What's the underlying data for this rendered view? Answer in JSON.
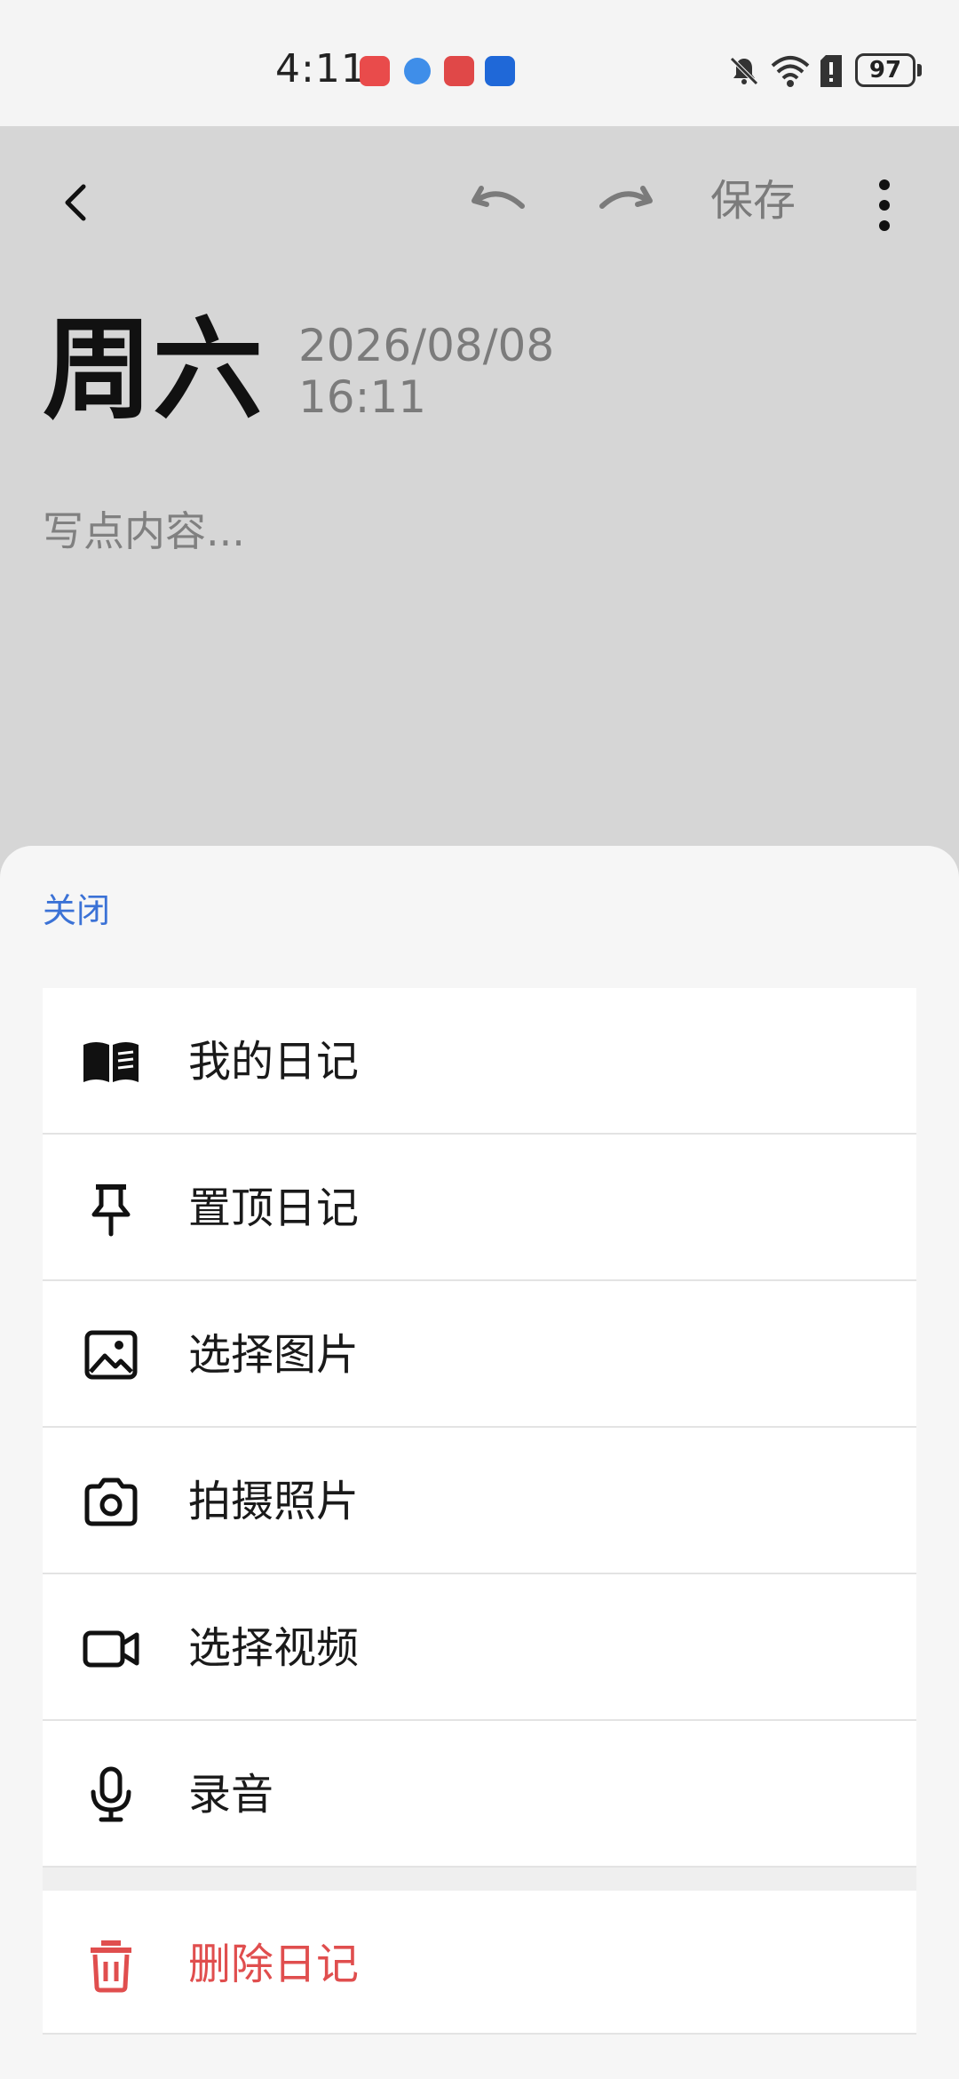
{
  "status_bar": {
    "time": "4:11",
    "app_icons": [
      "huawei-appgallery-icon",
      "browser-icon",
      "reader-icon",
      "tips-icon"
    ],
    "battery": "97"
  },
  "editor": {
    "save_label": "保存",
    "weekday": "周六",
    "date": "2026/08/08",
    "time": "16:11",
    "content_placeholder": "写点内容..."
  },
  "sheet": {
    "close_label": "关闭",
    "items": [
      {
        "label": "我的日记",
        "icon": "book-icon"
      },
      {
        "label": "置顶日记",
        "icon": "pin-icon"
      },
      {
        "label": "选择图片",
        "icon": "image-icon"
      },
      {
        "label": "拍摄照片",
        "icon": "camera-icon"
      },
      {
        "label": "选择视频",
        "icon": "video-icon"
      },
      {
        "label": "录音",
        "icon": "microphone-icon"
      }
    ],
    "delete_label": "删除日记"
  },
  "colors": {
    "accent": "#3b72d6",
    "danger": "#e04e4e",
    "dim_background": "#d6d6d6"
  }
}
